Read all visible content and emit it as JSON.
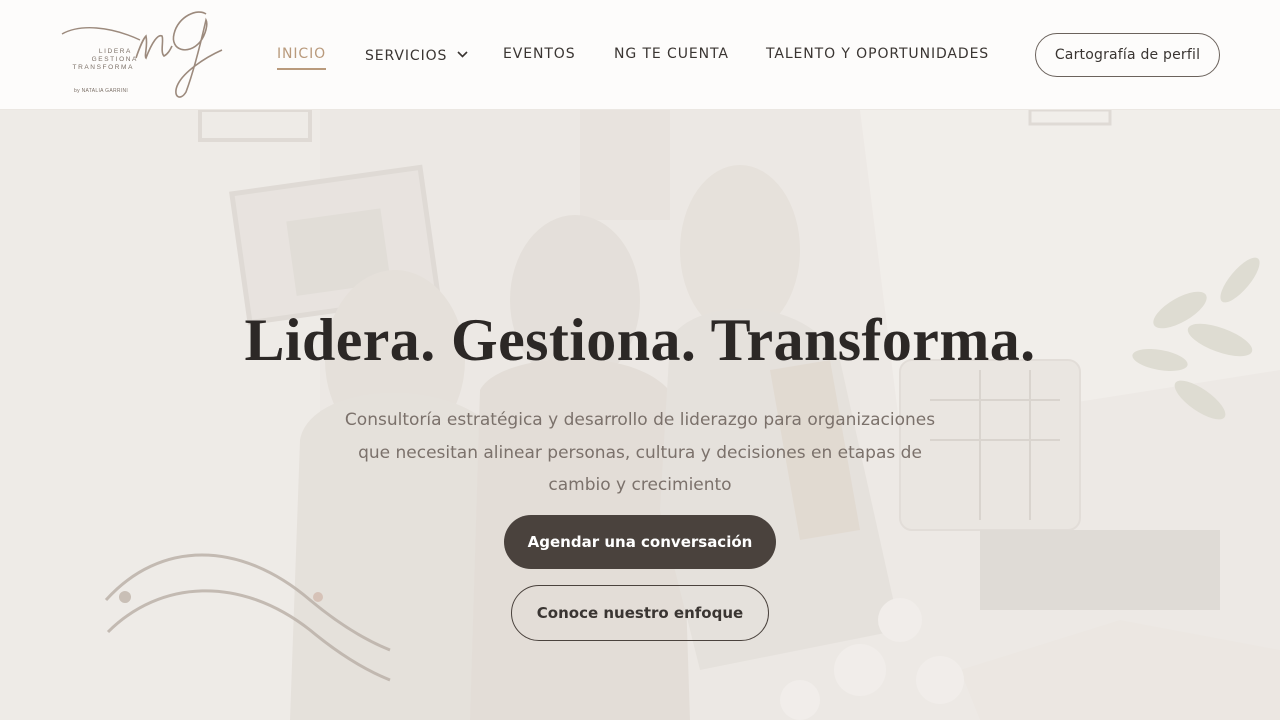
{
  "brand": {
    "logo_words": [
      "LIDERA",
      "GESTIONA",
      "TRANSFORMA"
    ],
    "byline": "by NATALIA GARRINI",
    "accent_color": "#b99a7c"
  },
  "nav": {
    "items": [
      {
        "label": "INICIO",
        "active": true
      },
      {
        "label": "SERVICIOS",
        "has_dropdown": true
      },
      {
        "label": "EVENTOS"
      },
      {
        "label": "NG TE CUENTA"
      },
      {
        "label": "TALENTO Y OPORTUNIDADES"
      }
    ],
    "cta_label": "Cartografía de perfil"
  },
  "hero": {
    "title": "Lidera. Gestiona. Transforma.",
    "subtitle": "Consultoría estratégica y desarrollo de liderazgo para organizaciones que necesitan alinear personas, cultura y decisiones en etapas de cambio y crecimiento",
    "primary_button": "Agendar una conversación",
    "secondary_button": "Conoce nuestro enfoque",
    "primary_button_color": "#4a423d"
  },
  "icons": {
    "dropdown": "chevron-down-icon"
  }
}
